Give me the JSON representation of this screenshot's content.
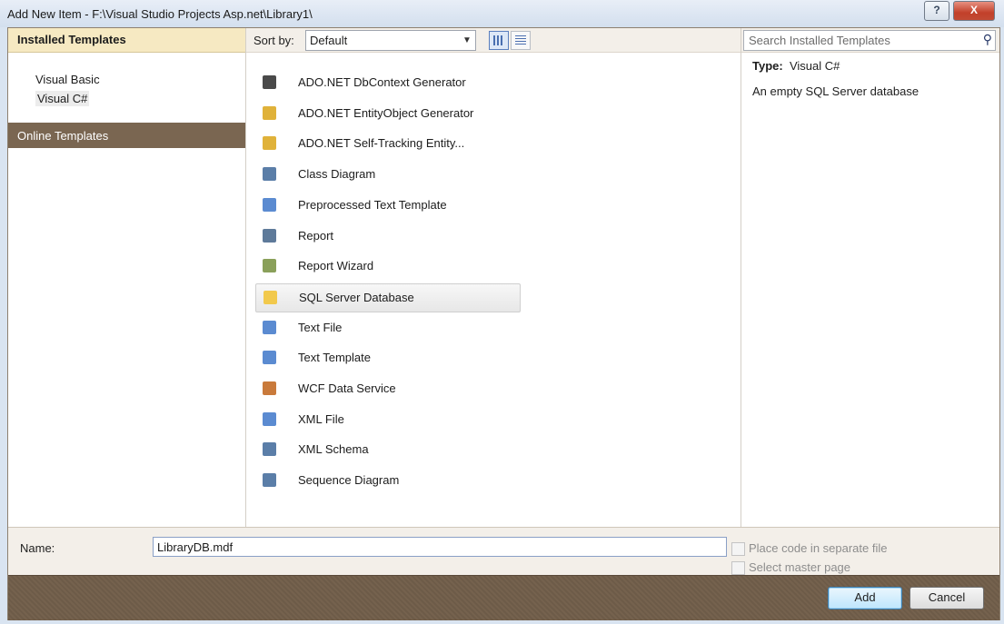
{
  "window": {
    "title": "Add New Item - F:\\Visual Studio Projects Asp.net\\Library1\\",
    "help_label": "?",
    "close_label": "X"
  },
  "left_panel": {
    "header": "Installed Templates",
    "tree": [
      "Visual Basic",
      "Visual C#"
    ],
    "online": "Online Templates"
  },
  "toolbar": {
    "sort_label": "Sort by:",
    "sort_value": "Default"
  },
  "templates": [
    {
      "label": "ADO.NET DbContext Generator",
      "icon": "generator-icon",
      "color": "#4a4a4a"
    },
    {
      "label": "ADO.NET EntityObject Generator",
      "icon": "generator-icon",
      "color": "#e0b23a"
    },
    {
      "label": "ADO.NET Self-Tracking Entity...",
      "icon": "generator-icon",
      "color": "#e0b23a"
    },
    {
      "label": "Class Diagram",
      "icon": "class-diagram-icon",
      "color": "#5b7ea8"
    },
    {
      "label": "Preprocessed Text Template",
      "icon": "text-template-icon",
      "color": "#5b8bd1"
    },
    {
      "label": "Report",
      "icon": "report-icon",
      "color": "#5e7a9a"
    },
    {
      "label": "Report Wizard",
      "icon": "report-wizard-icon",
      "color": "#8aa05a"
    },
    {
      "label": "SQL Server Database",
      "icon": "database-icon",
      "color": "#f2c94c"
    },
    {
      "label": "Text File",
      "icon": "text-file-icon",
      "color": "#5b8bd1"
    },
    {
      "label": "Text Template",
      "icon": "text-template-icon",
      "color": "#5b8bd1"
    },
    {
      "label": "WCF Data Service",
      "icon": "service-icon",
      "color": "#c97a3b"
    },
    {
      "label": "XML File",
      "icon": "xml-file-icon",
      "color": "#5b8bd1"
    },
    {
      "label": "XML Schema",
      "icon": "xml-schema-icon",
      "color": "#5b7ea8"
    },
    {
      "label": "Sequence Diagram",
      "icon": "sequence-diagram-icon",
      "color": "#5b7ea8"
    }
  ],
  "selected_template": "SQL Server Database",
  "search": {
    "placeholder": "Search Installed Templates"
  },
  "details": {
    "type_label": "Type:",
    "type_value": "Visual C#",
    "description": "An empty SQL Server database"
  },
  "bottom": {
    "name_label": "Name:",
    "name_value": "LibraryDB.mdf",
    "option1": "Place code in separate file",
    "option2": "Select master page"
  },
  "buttons": {
    "add": "Add",
    "cancel": "Cancel"
  }
}
